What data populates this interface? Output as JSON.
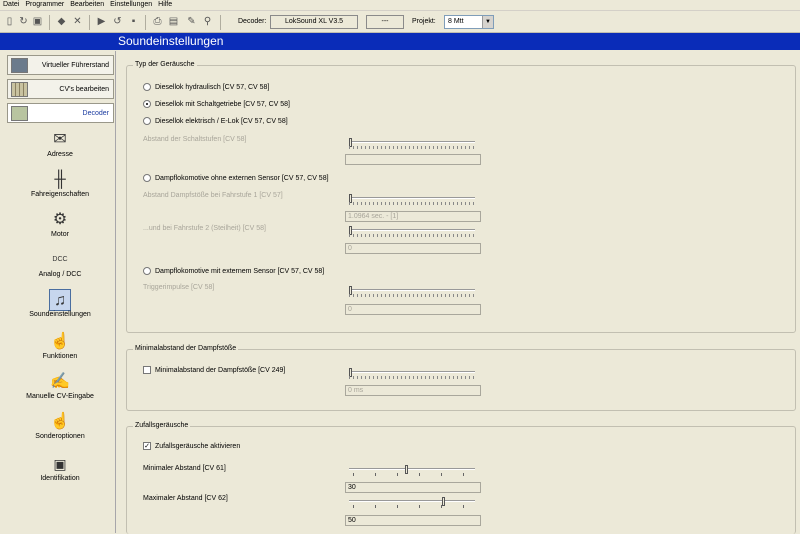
{
  "menu": [
    "Datei",
    "Programmer",
    "Bearbeiten",
    "Einstellungen",
    "Hilfe"
  ],
  "toolbar": {
    "decoder_label": "Decoder:",
    "decoder_value": "LokSound XL V3.5",
    "dash_value": "---",
    "projekt_label": "Projekt:",
    "projekt_value": "8 Mtt"
  },
  "title": "Soundeinstellungen",
  "sidebar": {
    "tabs": [
      "Virtueller Führerstand",
      "CV's bearbeiten",
      "Decoder"
    ],
    "items": [
      "Adresse",
      "Fahreigenschaften",
      "Motor",
      "Analog / DCC",
      "Soundeinstellungen",
      "Funktionen",
      "Manuelle CV-Eingabe",
      "Sonderoptionen",
      "Identifikation"
    ],
    "dcc_icon_text": "DCC"
  },
  "typ": {
    "legend": "Typ der Geräusche",
    "r1": "Diesellok hydraulisch [CV 57, CV 58]",
    "r2": "Diesellok mit Schaltgetriebe [CV 57, CV 58]",
    "r3": "Diesellok elektrisch / E-Lok [CV 57, CV 58]",
    "abstand_schalt": "Abstand der Schaltstufen [CV 58]",
    "r4": "Dampflokomotive ohne externen Sensor [CV 57, CV 58]",
    "abstand_dampf1": "Abstand Dampfstöße bei Fahrstufe 1 [CV 57]",
    "field_dampf1": "1.0964 sec. - [1]",
    "abstand_dampf2": "...und bei Fahrstufe 2 (Steilheit) [CV 58]",
    "field_dampf2": "0",
    "r5": "Dampflokomotive mit externem Sensor [CV 57, CV 58]",
    "trigger": "Triggerimpulse [CV 58]",
    "field_trigger": "0"
  },
  "minimal": {
    "legend": "Minimalabstand der Dampfstöße",
    "check": "Minimalabstand der Dampfstöße [CV 249]",
    "field": "0 ms"
  },
  "zufall": {
    "legend": "Zufallsgeräusche",
    "check": "Zufallsgeräusche aktivieren",
    "min_label": "Minimaler Abstand [CV 61]",
    "min_value": "30",
    "min_level": 0.45,
    "max_label": "Maximaler Abstand [CV 62]",
    "max_value": "50",
    "max_level": 0.75
  }
}
